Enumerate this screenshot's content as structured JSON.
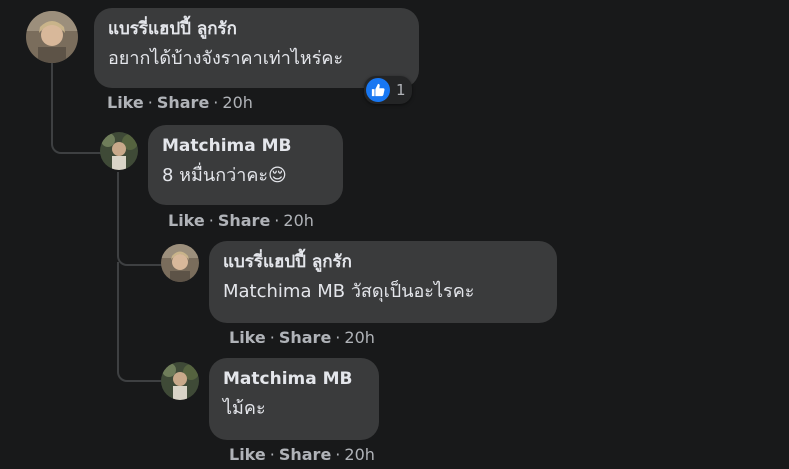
{
  "comments": [
    {
      "author": "แบรรี่แฮปปี้ ลูกรัก",
      "text": "อยากได้บ้างจังราคาเท่าไหร่คะ",
      "like": "Like",
      "share": "Share",
      "time": "20h",
      "reaction_count": "1"
    },
    {
      "author": "Matchima MB",
      "text": "8 หมื่นกว่าคะ😌",
      "like": "Like",
      "share": "Share",
      "time": "20h"
    },
    {
      "author": "แบรรี่แฮปปี้ ลูกรัก",
      "mention": "Matchima MB",
      "text": "วัสดุเป็นอะไรคะ",
      "like": "Like",
      "share": "Share",
      "time": "20h"
    },
    {
      "author": "Matchima MB",
      "text": "ไม้คะ",
      "like": "Like",
      "share": "Share",
      "time": "20h"
    }
  ],
  "separator": "·",
  "colors": {
    "background": "#18191a",
    "bubble": "#3a3b3c",
    "text": "#e4e6eb",
    "secondary": "#b0b3b8",
    "like_blue": "#1877f2"
  }
}
